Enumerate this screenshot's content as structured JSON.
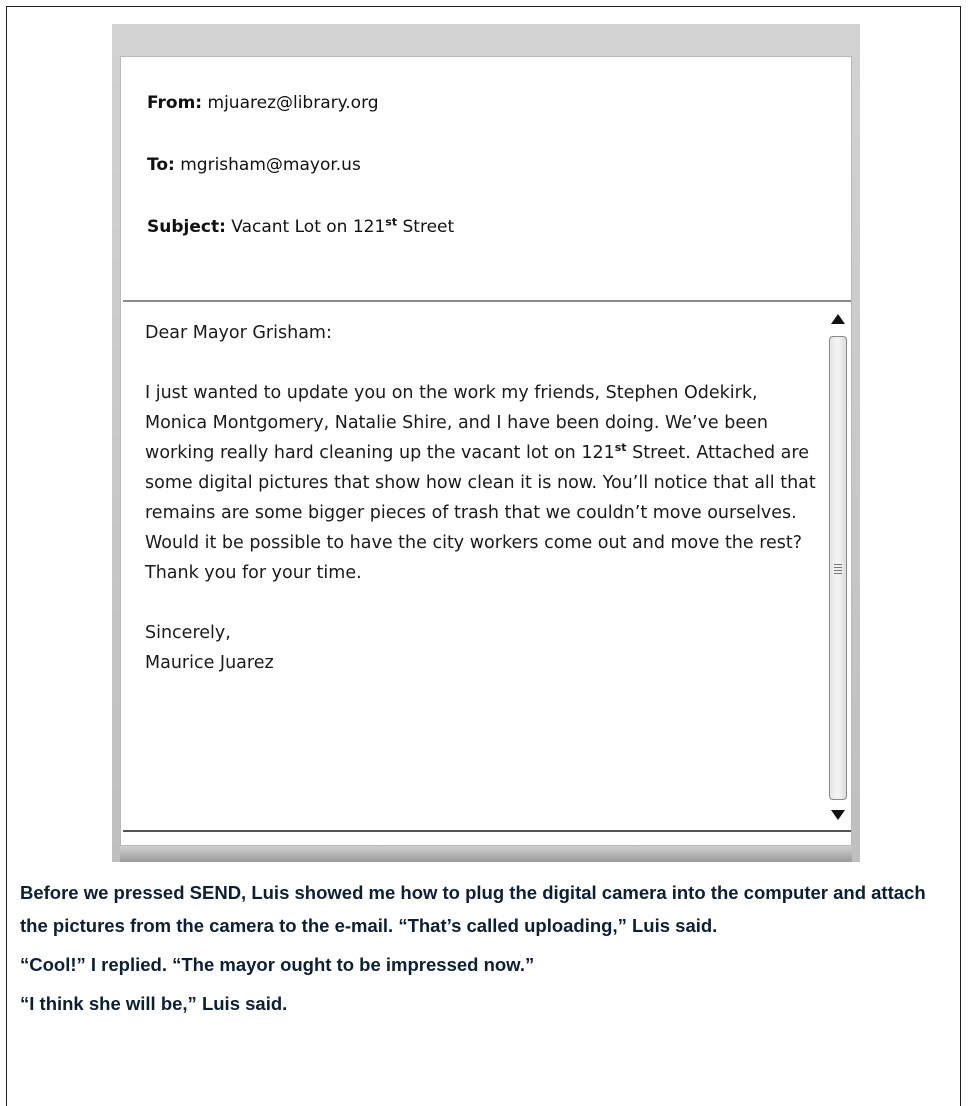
{
  "email": {
    "from": {
      "label": "From:",
      "value": "mjuarez@library.org"
    },
    "to": {
      "label": "To:",
      "value": "mgrisham@mayor.us"
    },
    "subject": {
      "label": "Subject:",
      "value_before": "Vacant Lot on 121",
      "value_sup": "st",
      "value_after": " Street"
    },
    "body": {
      "greeting": "Dear Mayor Grisham:",
      "paragraph_before": "I just wanted to update you on the work my friends, Stephen Odekirk, Monica Montgomery, Natalie Shire, and I have been doing. We’ve been working really hard cleaning up the vacant lot on 121",
      "paragraph_sup": "st",
      "paragraph_after": " Street. Attached are some digital pictures that show how clean it is now. You’ll notice that all that remains are some bigger pieces of trash that we couldn’t move ourselves. Would it be possible to have the city workers come out and move the rest? Thank you for your time.",
      "closing": "Sincerely,",
      "signature": "Maurice Juarez"
    }
  },
  "narrative": [
    "Before we pressed SEND, Luis showed me how to plug the digital camera into the computer and attach the pictures from the camera to the e-mail. “That’s called uploading,” Luis said.",
    "“Cool!” I replied. “The mayor ought to be impressed now.”",
    "“I think she will be,” Luis said."
  ],
  "icons": {
    "scroll_up": "triangle-up-icon",
    "scroll_down": "triangle-down-icon",
    "grip": "scroll-grip-icon"
  }
}
